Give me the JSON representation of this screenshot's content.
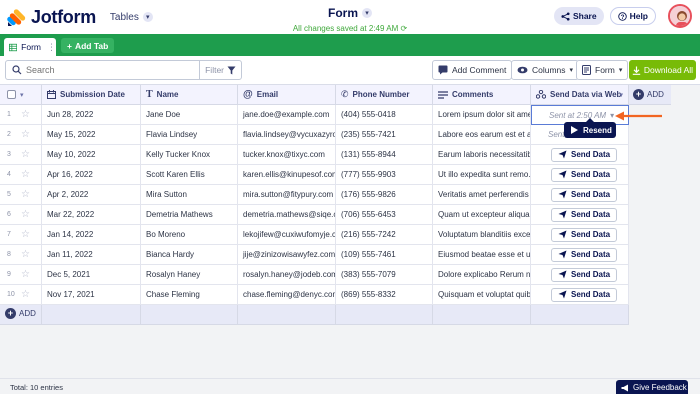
{
  "header": {
    "brand": "Jotform",
    "tables_label": "Tables",
    "form_title": "Form",
    "saved_status": "All changes saved at 2:49 AM",
    "share_label": "Share",
    "help_label": "Help"
  },
  "tabs": {
    "active_label": "Form",
    "add_label": "Add Tab"
  },
  "toolbar": {
    "search_placeholder": "Search",
    "filter_label": "Filter",
    "add_comment_label": "Add Comment",
    "columns_label": "Columns",
    "form_label": "Form",
    "download_label": "Download All"
  },
  "columns": [
    {
      "label": "Submission Date",
      "icon": "calendar-icon"
    },
    {
      "label": "Name",
      "icon": "text-icon"
    },
    {
      "label": "Email",
      "icon": "at-icon"
    },
    {
      "label": "Phone Number",
      "icon": "phone-icon"
    },
    {
      "label": "Comments",
      "icon": "paragraph-icon"
    },
    {
      "label": "Send Data via Web...",
      "icon": "send-data-icon"
    }
  ],
  "add_column_label": "ADD",
  "rows": [
    {
      "num": "1",
      "date": "Jun 28, 2022",
      "name": "Jane Doe",
      "email": "jane.doe@example.com",
      "phone": "(404) 555-0418",
      "comment": "Lorem ipsum dolor sit ame...",
      "action": "Sent at 2:50 AM"
    },
    {
      "num": "2",
      "date": "May 15, 2022",
      "name": "Flavia Lindsey",
      "email": "flavia.lindsey@vycuxazyro...",
      "phone": "(235) 555-7421",
      "comment": "Labore eos earum est et ae...",
      "action": "Sent"
    },
    {
      "num": "3",
      "date": "May 10, 2022",
      "name": "Kelly Tucker Knox",
      "email": "tucker.knox@tixyc.com",
      "phone": "(131) 555-8944",
      "comment": "Earum laboris necessitatib...",
      "action": "Send Data"
    },
    {
      "num": "4",
      "date": "Apr 16, 2022",
      "name": "Scott Karen Ellis",
      "email": "karen.ellis@kinupesof.com",
      "phone": "(777) 555-9903",
      "comment": "Ut illo expedita sunt remo...",
      "action": "Send Data"
    },
    {
      "num": "5",
      "date": "Apr 2, 2022",
      "name": "Mira Sutton",
      "email": "mira.sutton@fitypury.com",
      "phone": "(176) 555-9826",
      "comment": "Veritatis amet perferendis ...",
      "action": "Send Data"
    },
    {
      "num": "6",
      "date": "Mar 22, 2022",
      "name": "Demetria Mathews",
      "email": "demetria.mathews@siqe.c...",
      "phone": "(706) 555-6453",
      "comment": "Quam ut excepteur aliqua ...",
      "action": "Send Data"
    },
    {
      "num": "7",
      "date": "Jan 14, 2022",
      "name": "Bo Moreno",
      "email": "lekojifew@cuxiwufomyje.c...",
      "phone": "(216) 555-7242",
      "comment": "Voluptatum blanditiis exce...",
      "action": "Send Data"
    },
    {
      "num": "8",
      "date": "Jan 11, 2022",
      "name": "Bianca Hardy",
      "email": "jije@zinizowisawyfez.com",
      "phone": "(109) 555-7461",
      "comment": "Eiusmod beatae esse et ut...",
      "action": "Send Data"
    },
    {
      "num": "9",
      "date": "Dec 5, 2021",
      "name": "Rosalyn Haney",
      "email": "rosalyn.haney@jodeb.com",
      "phone": "(383) 555-7079",
      "comment": "Dolore explicabo Rerum n...",
      "action": "Send Data"
    },
    {
      "num": "10",
      "date": "Nov 17, 2021",
      "name": "Chase Fleming",
      "email": "chase.fleming@denyc.com",
      "phone": "(869) 555-8332",
      "comment": "Quisquam et voluptat quib...",
      "action": "Send Data"
    }
  ],
  "resend_label": "Resend",
  "add_row_label": "ADD",
  "footer": {
    "total": "Total: 10 entries",
    "feedback": "Give Feedback"
  },
  "colors": {
    "green_bar": "#1e9d4d",
    "download": "#78bb07",
    "navy": "#0a1551",
    "arrow": "#f26522"
  }
}
